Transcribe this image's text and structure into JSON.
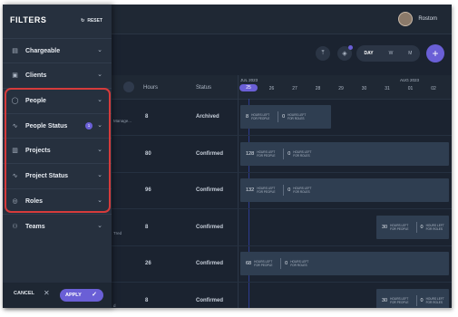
{
  "user": {
    "name": "Rostom"
  },
  "toolbar": {
    "view_options": [
      "DAY",
      "W",
      "M"
    ],
    "selected_view": "DAY",
    "add_label": "+"
  },
  "grid": {
    "headers": {
      "hours": "Hours",
      "status": "Status"
    },
    "months": [
      "JUL 2023",
      "AUG 2023"
    ],
    "days": [
      "25",
      "26",
      "27",
      "28",
      "29",
      "30",
      "31",
      "01",
      "02"
    ],
    "active_day": "25",
    "project_fragments": [
      "Manage...",
      "Tred",
      "d"
    ],
    "rows": [
      {
        "hours": "8",
        "status": "Archived",
        "bars": [
          {
            "num": "8",
            "hours_label": "HOURS LEFT FOR PEOPLE",
            "roles_num": "0",
            "roles_label": "HOURS LEFT FOR ROLES"
          }
        ]
      },
      {
        "hours": "80",
        "status": "Confirmed",
        "bars": [
          {
            "num": "128",
            "hours_label": "HOURS LEFT FOR PEOPLE",
            "roles_num": "0",
            "roles_label": "HOURS LEFT FOR ROLES"
          }
        ]
      },
      {
        "hours": "96",
        "status": "Confirmed",
        "bars": [
          {
            "num": "132",
            "hours_label": "HOURS LEFT FOR PEOPLE",
            "roles_num": "0",
            "roles_label": "HOURS LEFT FOR ROLES"
          }
        ]
      },
      {
        "hours": "8",
        "status": "Confirmed",
        "bars": [
          {
            "num": "30",
            "hours_label": "HOURS LEFT FOR PEOPLE",
            "roles_num": "0",
            "roles_label": "HOURS LEFT FOR ROLES"
          }
        ]
      },
      {
        "hours": "26",
        "status": "Confirmed",
        "bars": [
          {
            "num": "68",
            "hours_label": "HOURS LEFT FOR PEOPLE",
            "roles_num": "0",
            "roles_label": "HOURS LEFT FOR ROLES"
          }
        ]
      },
      {
        "hours": "8",
        "status": "Confirmed",
        "bars": [
          {
            "num": "30",
            "hours_label": "HOURS LEFT FOR PEOPLE",
            "roles_num": "0",
            "roles_label": "HOURS LEFT FOR ROLES"
          }
        ]
      }
    ]
  },
  "filters": {
    "title": "FILTERS",
    "reset_label": "RESET",
    "items": [
      {
        "label": "Chargeable",
        "icon": "wallet-icon"
      },
      {
        "label": "Clients",
        "icon": "briefcase-icon"
      },
      {
        "label": "People",
        "icon": "user-icon"
      },
      {
        "label": "People Status",
        "icon": "activity-icon",
        "badge": "1"
      },
      {
        "label": "Projects",
        "icon": "chart-icon"
      },
      {
        "label": "Project Status",
        "icon": "activity-icon"
      },
      {
        "label": "Roles",
        "icon": "fingerprint-icon"
      },
      {
        "label": "Teams",
        "icon": "users-icon"
      }
    ],
    "cancel_label": "CANCEL",
    "apply_label": "APPLY"
  },
  "colors": {
    "accent": "#6a5fd6",
    "highlight": "#d63b3b",
    "panel": "#26303e",
    "background": "#1b2330"
  }
}
